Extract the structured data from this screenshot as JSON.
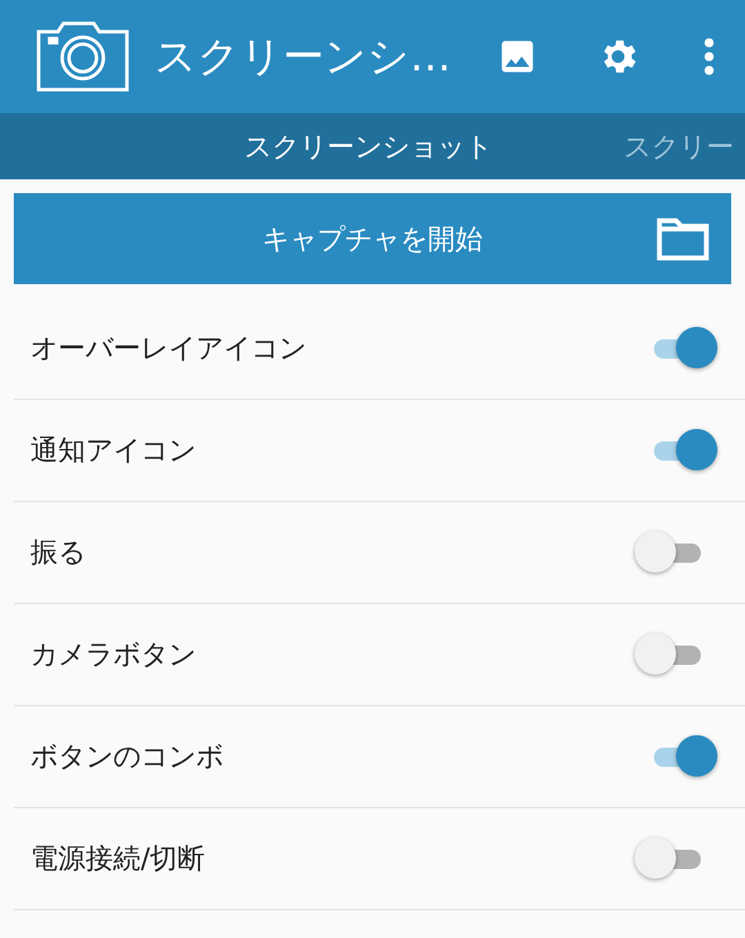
{
  "app_bar": {
    "title": "スクリーンシ…"
  },
  "tabs": [
    {
      "label": "スクリーンショット",
      "selected": true
    },
    {
      "label": "スクリー",
      "selected": false
    }
  ],
  "capture_button": {
    "label": "キャプチャを開始"
  },
  "settings": [
    {
      "label": "オーバーレイアイコン",
      "on": true
    },
    {
      "label": "通知アイコン",
      "on": true
    },
    {
      "label": "振る",
      "on": false
    },
    {
      "label": "カメラボタン",
      "on": false
    },
    {
      "label": "ボタンのコンボ",
      "on": true
    },
    {
      "label": "電源接続/切断",
      "on": false
    }
  ]
}
